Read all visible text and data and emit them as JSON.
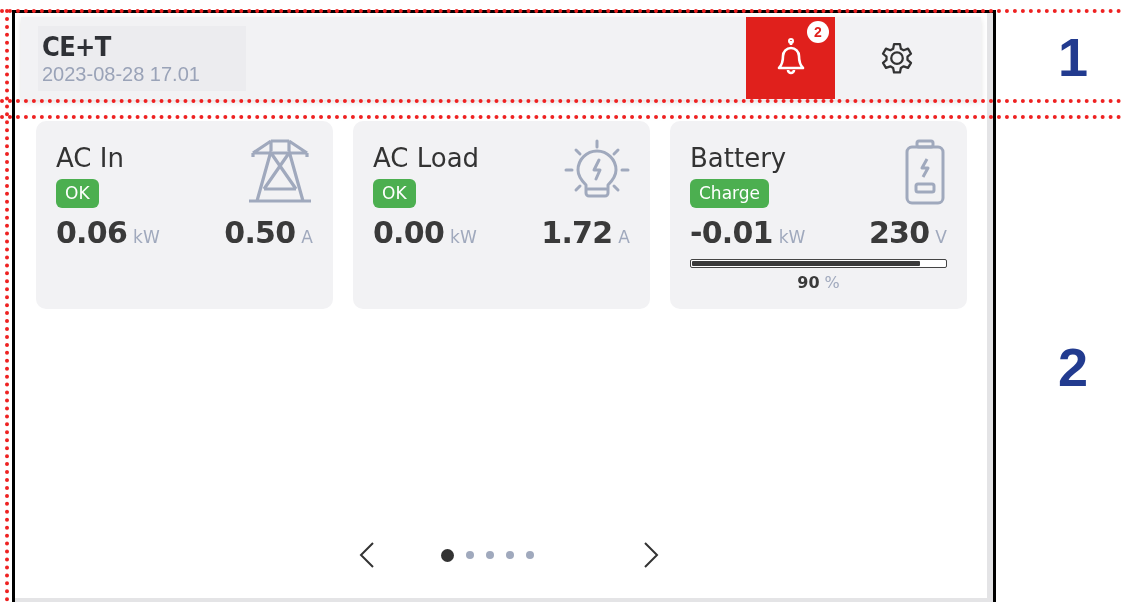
{
  "header": {
    "title": "CE+T",
    "datetime": "2023-08-28 17.01",
    "notifications": {
      "count": "2"
    }
  },
  "cards": [
    {
      "kind": "grid",
      "title": "AC In",
      "status": "OK",
      "power": "0.06",
      "power_unit": "kW",
      "secondary": "0.50",
      "secondary_unit": "A"
    },
    {
      "kind": "load",
      "title": "AC Load",
      "status": "OK",
      "power": "0.00",
      "power_unit": "kW",
      "secondary": "1.72",
      "secondary_unit": "A"
    },
    {
      "kind": "battery",
      "title": "Battery",
      "status": "Charge",
      "power": "-0.01",
      "power_unit": "kW",
      "secondary": "230",
      "secondary_unit": "V",
      "level": 0.9,
      "percent": "90",
      "percent_unit": "%"
    }
  ],
  "pager": {
    "pages": [
      {
        "selected": true
      },
      {
        "selected": false
      },
      {
        "selected": false
      },
      {
        "selected": false
      },
      {
        "selected": false
      }
    ]
  },
  "annotations": [
    "1",
    "2"
  ]
}
